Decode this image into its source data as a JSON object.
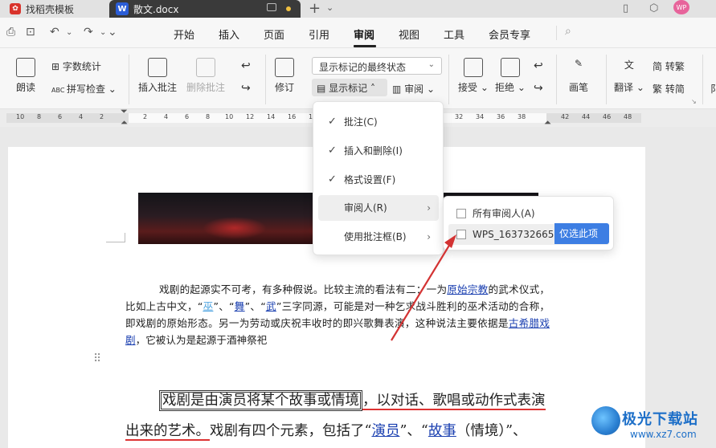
{
  "titlebar": {
    "tab1_label": "找稻壳模板",
    "tab2_label": "散文.docx",
    "wps_logo_text": "W",
    "avatar_text": "WP"
  },
  "menubar": {
    "items": [
      "开始",
      "插入",
      "页面",
      "引用",
      "审阅",
      "视图",
      "工具",
      "会员专享"
    ],
    "active_item": "审阅"
  },
  "ribbon": {
    "read_aloud": "朗读",
    "word_count": "字数统计",
    "spell_check": "拼写检查",
    "insert_comment": "插入批注",
    "delete_comment": "删除批注",
    "track_changes": "修订",
    "status_dropdown": "显示标记的最终状态",
    "show_markup": "显示标记",
    "review": "审阅",
    "accept": "接受",
    "reject": "拒绝",
    "pen": "画笔",
    "translate": "翻译",
    "to_traditional": "简 转繁",
    "to_simplified": "繁 转简",
    "compare_partial": "阝"
  },
  "ruler": {
    "ticks": [
      "10",
      "8",
      "6",
      "4",
      "2",
      "2",
      "4",
      "6",
      "8",
      "10",
      "12",
      "14",
      "16",
      "18",
      "32",
      "34",
      "36",
      "38",
      "42",
      "44",
      "46",
      "48"
    ]
  },
  "dropdown": {
    "items": [
      {
        "label": "批注(C)",
        "checked": true
      },
      {
        "label": "插入和删除(I)",
        "checked": true
      },
      {
        "label": "格式设置(F)",
        "checked": true
      },
      {
        "label": "审阅人(R)",
        "checked": false,
        "submenu": true
      },
      {
        "label": "使用批注框(B)",
        "checked": false,
        "submenu": true
      }
    ]
  },
  "submenu": {
    "all_reviewers": "所有审阅人(A)",
    "reviewer": "WPS_1637326656",
    "only_this": "仅选此项"
  },
  "document": {
    "para1": {
      "t1": "戏剧的起源实不可考，有多种假说。比较主流的看法有二：一为",
      "l1": "原始宗教",
      "t2": "的武术仪式，比如上古中文，“",
      "l2": "巫",
      "t3": "”、“",
      "l3": "舞",
      "t4": "”、“",
      "l4": "武",
      "t5": "”三字同源，可能是对一种乞求战斗胜利的巫术活动的合称，即戏剧的原始形态。另一为劳动或庆祝丰收时的即兴歌舞表演，这种说法主要依据是",
      "l5": "古希腊戏剧",
      "t6": "，它被认为是起源于酒神祭祀"
    },
    "para2": {
      "boxed": "戏剧是由演员将某个故事或情境",
      "t1": "，以对话、歌唱或动作式表",
      "red": "演出来的艺术。",
      "t2": "戏剧有四个元素，包括了“",
      "l1": "演员",
      "t3": "”、“",
      "l2": "故事",
      "t4": "（情境）”、"
    }
  },
  "watermark": {
    "title": "极光下载站",
    "url": "www.xz7.com"
  },
  "colors": {
    "accent_blue": "#3d7ee3",
    "link_blue": "#1a3fb0",
    "annotation_red": "#d33333"
  }
}
